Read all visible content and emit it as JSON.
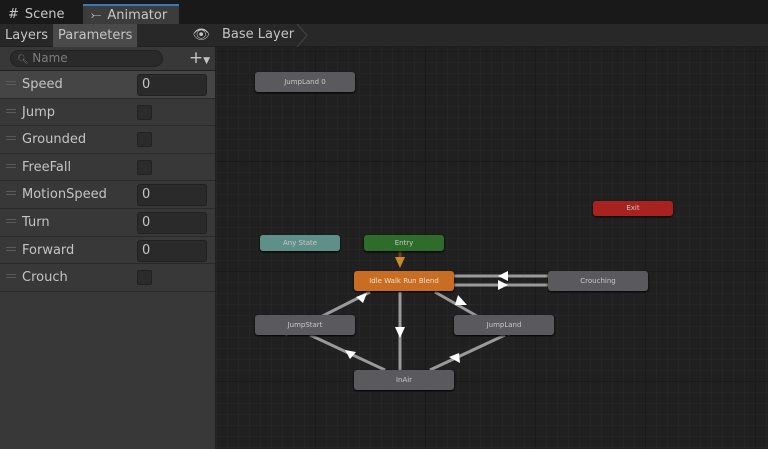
{
  "tabs": [
    {
      "label": "Scene",
      "icon": "grid-icon"
    },
    {
      "label": "Animator",
      "icon": "animator-icon"
    }
  ],
  "subtabs": {
    "layers": "Layers",
    "parameters": "Parameters"
  },
  "search": {
    "placeholder": "Name"
  },
  "parameters": [
    {
      "name": "Speed",
      "type": "float",
      "value": "0"
    },
    {
      "name": "Jump",
      "type": "bool"
    },
    {
      "name": "Grounded",
      "type": "bool"
    },
    {
      "name": "FreeFall",
      "type": "bool"
    },
    {
      "name": "MotionSpeed",
      "type": "float",
      "value": "0"
    },
    {
      "name": "Turn",
      "type": "float",
      "value": "0"
    },
    {
      "name": "Forward",
      "type": "float",
      "value": "0"
    },
    {
      "name": "Crouch",
      "type": "bool"
    }
  ],
  "breadcrumb": "Base Layer",
  "states": {
    "jumpland0": "JumpLand 0",
    "exit": "Exit",
    "any": "Any State",
    "entry": "Entry",
    "idle": "Idle Walk Run Blend",
    "crouching": "Crouching",
    "jumpstart": "JumpStart",
    "jumpland": "JumpLand",
    "inair": "InAir"
  },
  "colors": {
    "exit": "#a8221f",
    "any": "#5e9088",
    "entry": "#2e6c2c",
    "default": "#c96d22",
    "accent": "#3a79bb"
  }
}
